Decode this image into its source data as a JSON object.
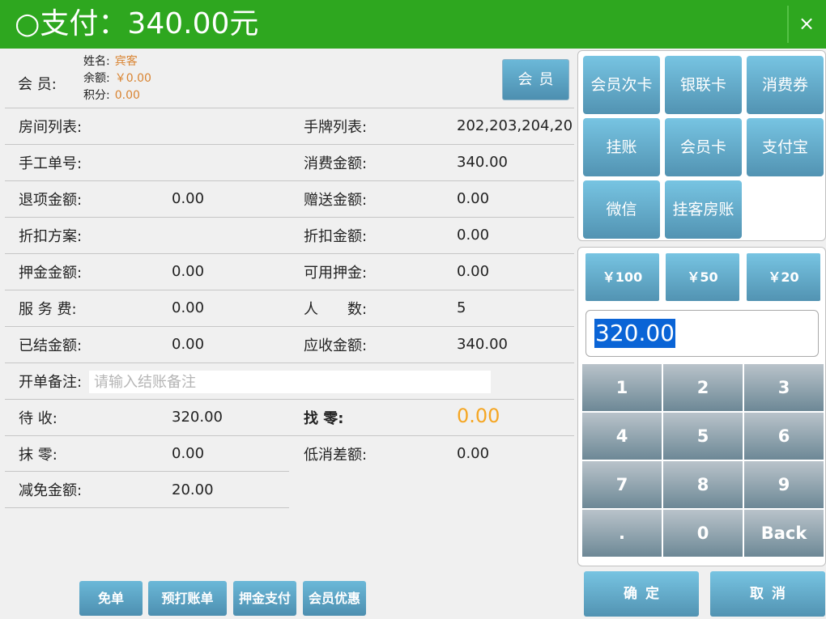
{
  "header": {
    "title": "○支付：340.00元",
    "close_label": "×"
  },
  "member": {
    "label": "会 员:",
    "name_key": "姓名:",
    "name_value": "宾客",
    "balance_key": "余额:",
    "balance_value": "￥0.00",
    "points_key": "积分:",
    "points_value": "0.00",
    "button_label": "会员"
  },
  "fields": {
    "room_list": {
      "label": "房间列表:",
      "value": ""
    },
    "tag_list": {
      "label": "手牌列表:",
      "value": "202,203,204,20"
    },
    "manual_no": {
      "label": "手工单号:",
      "value": ""
    },
    "consume": {
      "label": "消费金额:",
      "value": "340.00"
    },
    "refund": {
      "label": "退项金额:",
      "value": "0.00"
    },
    "gift": {
      "label": "赠送金额:",
      "value": "0.00"
    },
    "discount_plan": {
      "label": "折扣方案:",
      "value": ""
    },
    "discount_amount": {
      "label": "折扣金额:",
      "value": "0.00"
    },
    "deposit": {
      "label": "押金金额:",
      "value": "0.00"
    },
    "deposit_avail": {
      "label": "可用押金:",
      "value": "0.00"
    },
    "service_fee": {
      "label": "服 务 费:",
      "value": "0.00"
    },
    "people": {
      "label": "人　　数:",
      "value": "5"
    },
    "settled": {
      "label": "已结金额:",
      "value": "0.00"
    },
    "receivable": {
      "label": "应收金额:",
      "value": "340.00"
    },
    "note": {
      "label": "开单备注:",
      "placeholder": "请输入结账备注"
    },
    "pending": {
      "label": "待 收:",
      "value": "320.00"
    },
    "change": {
      "label": "找 零:",
      "value": "0.00"
    },
    "rounding": {
      "label": "抹 零:",
      "value": "0.00"
    },
    "min_diff": {
      "label": "低消差额:",
      "value": "0.00"
    },
    "reduction": {
      "label": "减免金额:",
      "value": "20.00"
    }
  },
  "bottom_buttons": [
    "免单",
    "预打账单",
    "押金支付",
    "会员优惠"
  ],
  "payment_methods": [
    "会员次卡",
    "银联卡",
    "消费券",
    "挂账",
    "会员卡",
    "支付宝",
    "微信",
    "挂客房账"
  ],
  "quick_amounts": [
    "￥100",
    "￥50",
    "￥20"
  ],
  "amount_input": "320.00",
  "keypad": [
    "1",
    "2",
    "3",
    "4",
    "5",
    "6",
    "7",
    "8",
    "9",
    ".",
    "0",
    "Back"
  ],
  "actions": {
    "confirm": "确定",
    "cancel": "取消"
  },
  "colors": {
    "header_green": "#2ea71f",
    "button_blue": "#5293b2",
    "accent_orange": "#f5a623",
    "member_orange": "#d98432"
  }
}
